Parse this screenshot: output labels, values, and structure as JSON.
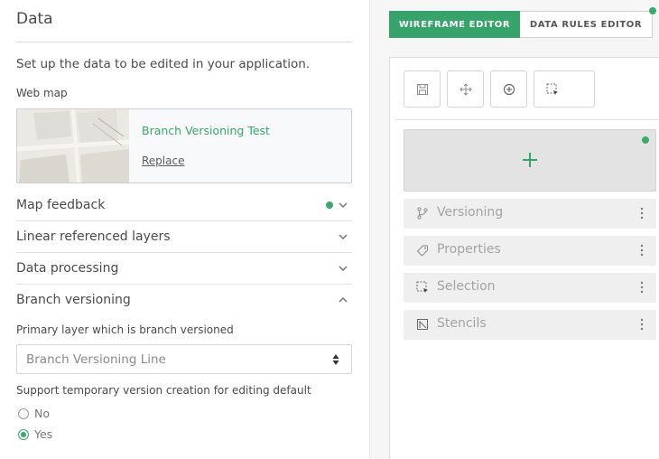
{
  "left": {
    "title": "Data",
    "intro": "Set up the data to be edited in your application.",
    "webmap_label": "Web map",
    "webmap": {
      "name": "Branch Versioning Test",
      "replace_label": "Replace"
    },
    "sections": [
      {
        "label": "Map feedback",
        "state": "collapsed",
        "has_status_dot": true
      },
      {
        "label": "Linear referenced layers",
        "state": "collapsed"
      },
      {
        "label": "Data processing",
        "state": "collapsed"
      },
      {
        "label": "Branch versioning",
        "state": "expanded"
      }
    ],
    "branch": {
      "primary_label": "Primary layer which is branch versioned",
      "primary_value": "Branch Versioning Line",
      "support_label": "Support temporary version creation for editing default",
      "options": [
        {
          "label": "No",
          "selected": false
        },
        {
          "label": "Yes",
          "selected": true
        }
      ]
    }
  },
  "right": {
    "tabs": [
      {
        "label": "WIREFRAME EDITOR",
        "active": true
      },
      {
        "label": "DATA RULES EDITOR",
        "active": false
      }
    ],
    "tools": [
      "save-icon",
      "move-icon",
      "add-circle-icon",
      "select-icon"
    ],
    "widgets": [
      {
        "label": "Versioning",
        "icon": "branch-icon"
      },
      {
        "label": "Properties",
        "icon": "tag-icon"
      },
      {
        "label": "Selection",
        "icon": "selection-icon"
      },
      {
        "label": "Stencils",
        "icon": "stencil-icon"
      }
    ]
  },
  "colors": {
    "accent": "#35a36a",
    "status_dot": "#35ac6c",
    "link": "#38a86a"
  }
}
